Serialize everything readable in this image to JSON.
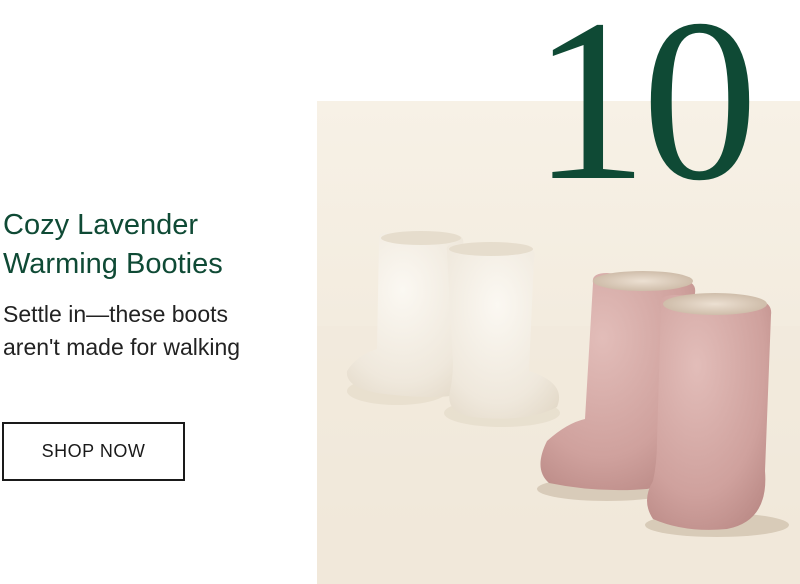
{
  "rank": "10",
  "product": {
    "title": "Cozy Lavender Warming Booties",
    "tagline": "Settle in—these boots aren't made for walking",
    "image_description_icon": "fuzzy-booties-photo"
  },
  "cta": {
    "label": "SHOP NOW"
  },
  "colors": {
    "brand_green": "#0f4a35",
    "photo_background": "#f6efe3",
    "cream_bootie": "#f4efe6",
    "pink_bootie": "#d3a7a4"
  }
}
